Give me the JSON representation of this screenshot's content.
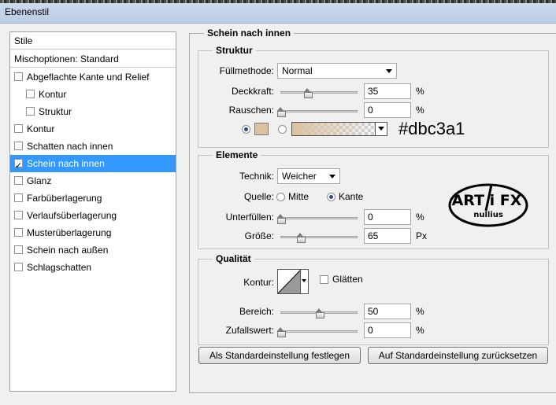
{
  "window": {
    "title": "Ebenenstil"
  },
  "sidebar": {
    "header": "Stile",
    "blending": "Mischoptionen: Standard",
    "items": [
      {
        "label": "Abgeflachte Kante und Relief",
        "checked": false,
        "indent": false
      },
      {
        "label": "Kontur",
        "checked": false,
        "indent": true
      },
      {
        "label": "Struktur",
        "checked": false,
        "indent": true
      },
      {
        "label": "Kontur",
        "checked": false,
        "indent": false
      },
      {
        "label": "Schatten nach innen",
        "checked": false,
        "indent": false
      },
      {
        "label": "Schein nach innen",
        "checked": true,
        "indent": false,
        "selected": true
      },
      {
        "label": "Glanz",
        "checked": false,
        "indent": false
      },
      {
        "label": "Farbüberlagerung",
        "checked": false,
        "indent": false
      },
      {
        "label": "Verlaufsüberlagerung",
        "checked": false,
        "indent": false
      },
      {
        "label": "Musterüberlagerung",
        "checked": false,
        "indent": false
      },
      {
        "label": "Schein nach außen",
        "checked": false,
        "indent": false
      },
      {
        "label": "Schlagschatten",
        "checked": false,
        "indent": false
      }
    ]
  },
  "panel": {
    "title": "Schein nach innen",
    "struktur": {
      "legend": "Struktur",
      "blend_label": "Füllmethode:",
      "blend_value": "Normal",
      "opacity_label": "Deckkraft:",
      "opacity_value": "35",
      "opacity_unit": "%",
      "opacity_level": 0.35,
      "noise_label": "Rauschen:",
      "noise_value": "0",
      "noise_unit": "%",
      "noise_level": 0,
      "color": "#dbc3a1",
      "color_hex_text": "#dbc3a1"
    },
    "elemente": {
      "legend": "Elemente",
      "technique_label": "Technik:",
      "technique_value": "Weicher",
      "source_label": "Quelle:",
      "source_center": "Mitte",
      "source_edge": "Kante",
      "choke_label": "Unterfüllen:",
      "choke_value": "0",
      "choke_unit": "%",
      "choke_level": 0,
      "size_label": "Größe:",
      "size_value": "65",
      "size_unit": "Px",
      "size_level": 0.26
    },
    "qualitaet": {
      "legend": "Qualität",
      "contour_label": "Kontur:",
      "antialias_label": "Glätten",
      "range_label": "Bereich:",
      "range_value": "50",
      "range_unit": "%",
      "range_level": 0.5,
      "jitter_label": "Zufallswert:",
      "jitter_value": "0",
      "jitter_unit": "%",
      "jitter_level": 0
    },
    "buttons": {
      "make_default": "Als Standardeinstellung festlegen",
      "reset_default": "Auf Standardeinstellung zurücksetzen"
    },
    "logo": {
      "line1": "ART i FX",
      "line2": "nullius"
    }
  }
}
